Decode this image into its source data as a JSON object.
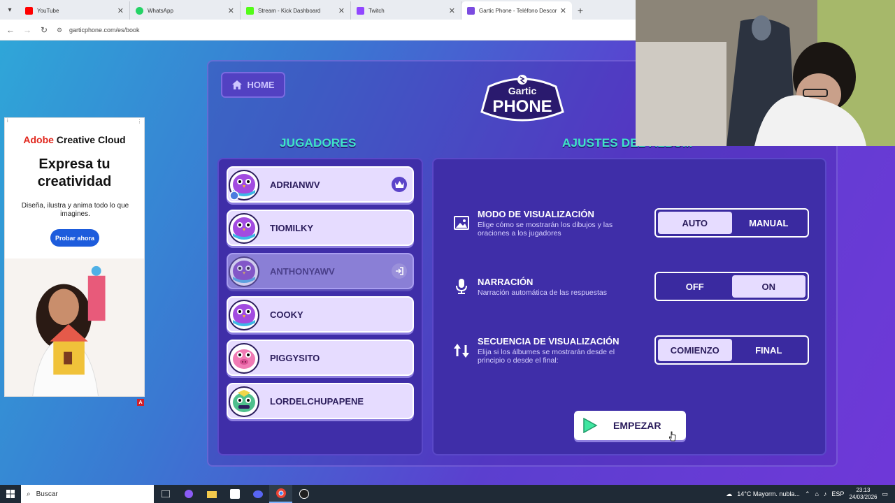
{
  "browser": {
    "tabs": [
      {
        "title": "YouTube",
        "color": "#ff0000",
        "active": false
      },
      {
        "title": "WhatsApp",
        "color": "#25d366",
        "active": false
      },
      {
        "title": "Stream - Kick Dashboard",
        "color": "#53fc18",
        "active": false
      },
      {
        "title": "Twitch",
        "color": "#9146ff",
        "active": false
      },
      {
        "title": "Gartic Phone - Teléfono Descor",
        "color": "#7b4be0",
        "active": true
      }
    ],
    "url": "garticphone.com/es/book"
  },
  "ad": {
    "choices_label": "i",
    "brand_red": "Adobe",
    "brand_black": " Creative Cloud",
    "headline_1": "Expresa tu",
    "headline_2": "creatividad",
    "subtitle": "Diseña, ilustra y anima todo lo que imagines.",
    "cta": "Probar ahora",
    "ad_badge": "A"
  },
  "game": {
    "home_label": "HOME",
    "logo_top": "Gartic",
    "logo_bottom": "PHONE",
    "players_title": "JUGADORES",
    "settings_title": "AJUSTES DEL ÁLBUM",
    "players": [
      {
        "name": "ADRIANWV",
        "avatar": "purple-bird",
        "badge": "crown-icon",
        "dim": false
      },
      {
        "name": "TIOMILKY",
        "avatar": "purple-bird",
        "badge": "",
        "dim": false
      },
      {
        "name": "ANTHONYAWV",
        "avatar": "purple-bird",
        "badge": "kick-icon",
        "dim": true
      },
      {
        "name": "COOKY",
        "avatar": "purple-bird",
        "badge": "",
        "dim": false
      },
      {
        "name": "PIGGYSITO",
        "avatar": "pink-pig",
        "badge": "",
        "dim": false
      },
      {
        "name": "LORDELCHUPAPENE",
        "avatar": "green-monster",
        "badge": "",
        "dim": false
      }
    ],
    "settings": [
      {
        "title": "MODO DE VISUALIZACIÓN",
        "desc": "Elige cómo se mostrarán los dibujos y las oraciones a los jugadores",
        "icon": "image-icon",
        "options": [
          "AUTO",
          "MANUAL"
        ],
        "selected": 0
      },
      {
        "title": "NARRACIÓN",
        "desc": "Narración automática de las respuestas",
        "icon": "microphone-icon",
        "options": [
          "OFF",
          "ON"
        ],
        "selected": 1
      },
      {
        "title": "SECUENCIA DE VISUALIZACIÓN",
        "desc": "Elija si los álbumes se mostrarán desde el principio o desde el final:",
        "icon": "sort-arrows-icon",
        "options": [
          "COMIENZO",
          "FINAL"
        ],
        "selected": 0
      }
    ],
    "start_label": "EMPEZAR"
  },
  "taskbar": {
    "search_placeholder": "Buscar",
    "weather": "14°C  Mayorm. nubla...",
    "lang": "ESP",
    "time": "23:13",
    "date": "24/03/2026"
  },
  "colors": {
    "accent_teal": "#3fe6c7",
    "panel": "#3f2ea8",
    "card": "#e6dcff"
  }
}
